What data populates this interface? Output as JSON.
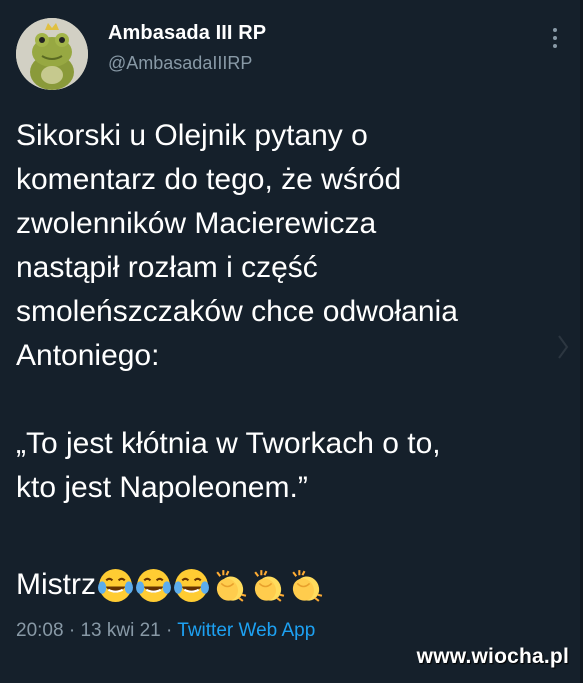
{
  "user": {
    "display_name": "Ambasada III RP",
    "handle": "@AmbasadaIIIRP",
    "avatar_icon": "frog-plush-avatar"
  },
  "tweet": {
    "text": "Sikorski u Olejnik pytany o\nkomentarz do tego, że wśród\nzwolenników Macierewicza\nnastąpił rozłam i część\nsmoleńszczaków chce odwołania\nAntoniego:\n\n„To jest kłótnia w Tworkach o to,\nkto jest Napoleonem.”",
    "closing_word": "Mistrz",
    "emojis": [
      "face-with-tears-of-joy",
      "face-with-tears-of-joy",
      "face-with-tears-of-joy",
      "clapping-hands",
      "clapping-hands",
      "clapping-hands"
    ]
  },
  "meta": {
    "time": "20:08",
    "separator1": " · ",
    "date": "13 kwi 21",
    "separator2": " · ",
    "source": "Twitter Web App"
  },
  "watermark": "www.wiocha.pl",
  "colors": {
    "background": "#15202b",
    "secondary_text": "#8899a6",
    "link": "#1da1f2"
  }
}
